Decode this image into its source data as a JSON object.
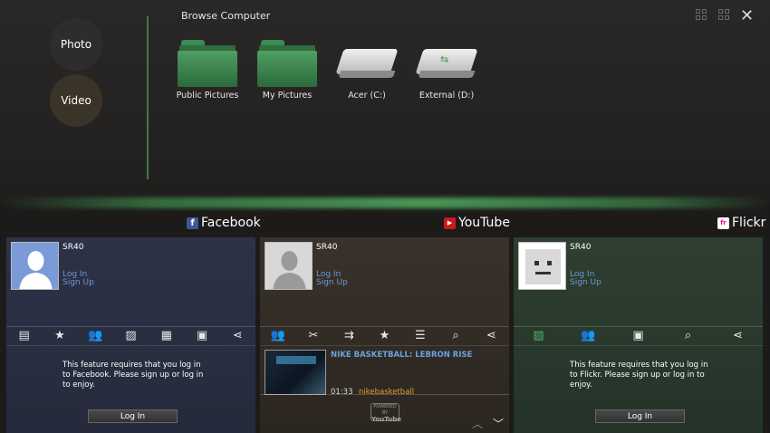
{
  "modes": {
    "photo": "Photo",
    "video": "Video"
  },
  "browse": {
    "title": "Browse Computer",
    "items": [
      {
        "label": "Public Pictures",
        "icon": "folder-icon"
      },
      {
        "label": "My Pictures",
        "icon": "folder-icon"
      },
      {
        "label": "Acer (C:)",
        "icon": "hard-drive-icon"
      },
      {
        "label": "External (D:)",
        "icon": "usb-drive-icon"
      }
    ]
  },
  "window": {
    "close": "✕"
  },
  "services": {
    "facebook": {
      "name": "Facebook",
      "logo": "f",
      "color": "#3b5998",
      "user": "SR40",
      "login_link": "Log In",
      "signup_link": "Sign Up",
      "message": "This feature requires that you log in to Facebook. Please sign up or log in to enjoy.",
      "login_button": "Log In",
      "tools": [
        "news-feed-icon",
        "favorite-friends-icon",
        "friends-icon",
        "photos-icon",
        "videos-icon",
        "profile-icon",
        "share-icon"
      ]
    },
    "youtube": {
      "name": "YouTube",
      "logo": "▶",
      "color": "#cc181e",
      "user": "SR40",
      "login_link": "Log In",
      "signup_link": "Sign Up",
      "tools": [
        "subscriptions-icon",
        "featured-icon",
        "most-viewed-icon",
        "favorites-icon",
        "list-icon",
        "search-icon",
        "share-icon"
      ],
      "video": {
        "title": "NIKE BASKETBALL: LEBRON RISE",
        "duration": "01:33",
        "author": "nikebasketball"
      },
      "powered_top": "POWERED BY",
      "powered_word": "YouTube"
    },
    "flickr": {
      "name": "Flickr",
      "logo": "fr",
      "color": "#ff0084",
      "user": "SR40",
      "login_link": "Log In",
      "signup_link": "Sign Up",
      "message": "This feature requires that you log in to Flickr. Please sign up or log in to enjoy.",
      "login_button": "Log In",
      "tools": [
        "photos-icon",
        "contacts-icon",
        "photostream-icon",
        "search-icon",
        "share-icon"
      ]
    }
  }
}
